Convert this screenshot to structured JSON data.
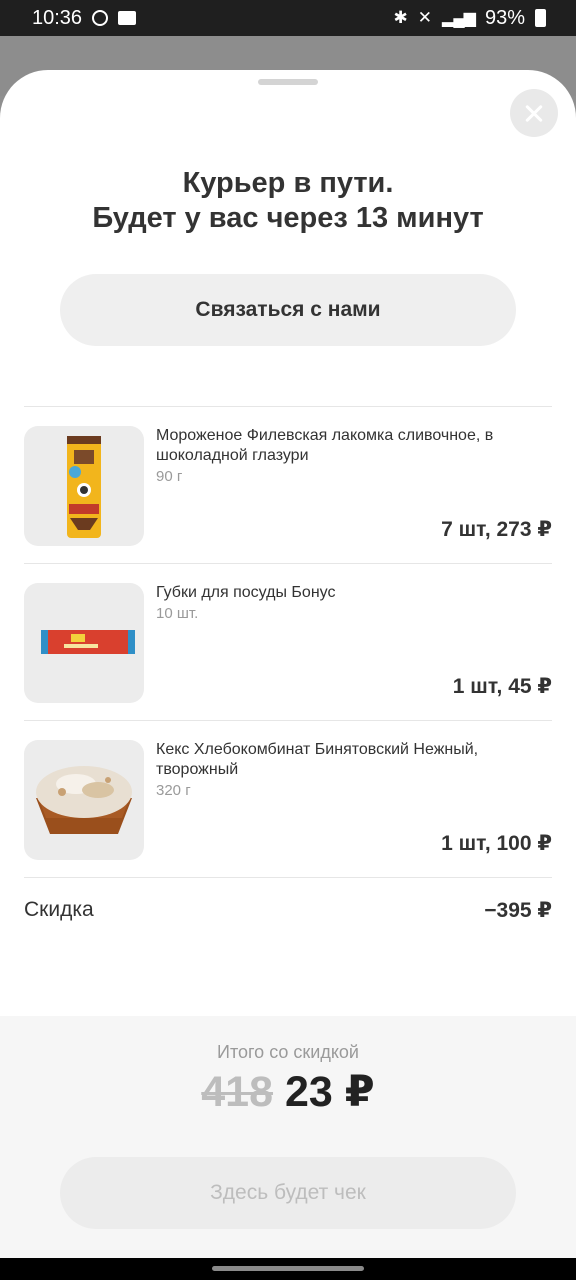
{
  "status_bar": {
    "time": "10:36",
    "battery": "93%",
    "network": "4G",
    "icons": [
      "alarm-icon",
      "folder-icon",
      "bluetooth-icon",
      "mute-icon",
      "signal-icon",
      "battery-icon"
    ]
  },
  "sheet": {
    "title_line1": "Курьер в пути.",
    "title_line2": "Будет у вас через 13 минут",
    "contact_button": "Связаться с нами"
  },
  "items": [
    {
      "name": "Мороженое Филевская лакомка сливочное, в шоколадной глазури",
      "weight": "90 г",
      "qty_price": "7 шт, 273 ₽"
    },
    {
      "name": "Губки для посуды Бонус",
      "weight": "10 шт.",
      "qty_price": "1 шт, 45 ₽"
    },
    {
      "name": "Кекс Хлебокомбинат Бинятовский Нежный, творожный",
      "weight": "320 г",
      "qty_price": "1 шт, 100 ₽"
    }
  ],
  "discount": {
    "label": "Скидка",
    "value": "−395 ₽"
  },
  "total": {
    "label": "Итого со скидкой",
    "old_price": "418",
    "new_price": "23 ₽"
  },
  "receipt_button": "Здесь будет чек",
  "colors": {
    "sheet_bg": "#ffffff",
    "footer_bg": "#f6f6f6",
    "button_bg": "#efefef",
    "muted_text": "#9a9a9a"
  }
}
